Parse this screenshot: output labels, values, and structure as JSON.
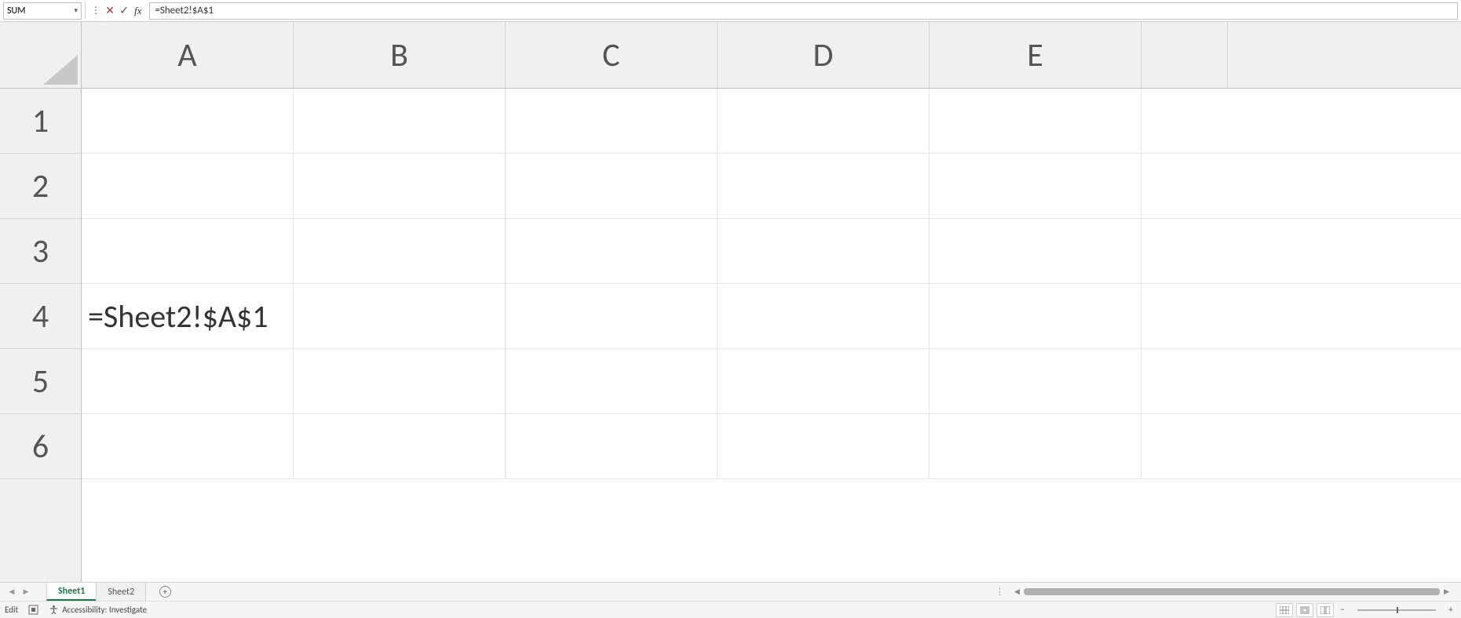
{
  "formula_bar": {
    "name_box": "SUM",
    "formula": "=Sheet2!$A$1"
  },
  "grid": {
    "columns": [
      "A",
      "B",
      "C",
      "D",
      "E"
    ],
    "rows": [
      "1",
      "2",
      "3",
      "4",
      "5",
      "6"
    ],
    "cells": {
      "A4": "=Sheet2!$A$1"
    }
  },
  "sheets": {
    "tabs": [
      {
        "name": "Sheet1",
        "active": true
      },
      {
        "name": "Sheet2",
        "active": false
      }
    ]
  },
  "status": {
    "mode": "Edit",
    "accessibility": "Accessibility: Investigate"
  }
}
